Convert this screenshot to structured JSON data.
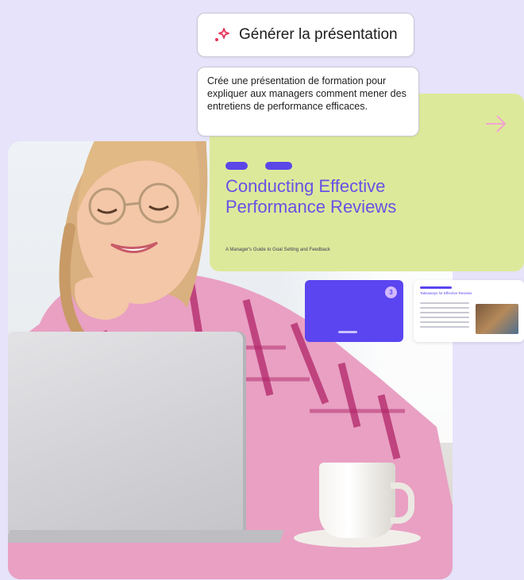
{
  "generate_button": {
    "label": "Générer la présentation",
    "icon": "sparkle-icon"
  },
  "prompt": {
    "text": "Crée une présentation de formation pour expliquer aux managers comment mener des entretiens de performance efficaces."
  },
  "slide_main": {
    "title": "Conducting Effective Performance Reviews",
    "subtitle": "A Manager's Guide to Goal Setting and Feedback",
    "icon": "arrow-right-icon"
  },
  "thumbnail_1": {
    "badge": "3"
  },
  "thumbnail_2": {
    "title": "Takeaways for Effective Reviews"
  },
  "colors": {
    "background": "#e6e3fb",
    "accent": "#5b46e8",
    "slide_bg": "#dde99a",
    "sparkle": "#e8365a"
  }
}
